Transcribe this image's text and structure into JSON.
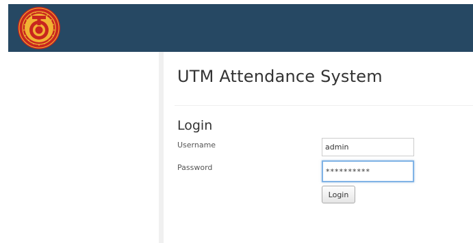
{
  "header": {
    "logo_icon": "utm-logo-icon",
    "bar_color": "#264863",
    "logo_primary_color": "#c8261e",
    "logo_accent_color": "#f2b233"
  },
  "main": {
    "title": "UTM Attendance System",
    "login": {
      "heading": "Login",
      "username_label": "Username",
      "username_value": "admin",
      "password_label": "Password",
      "password_value": "**********",
      "submit_label": "Login"
    }
  }
}
